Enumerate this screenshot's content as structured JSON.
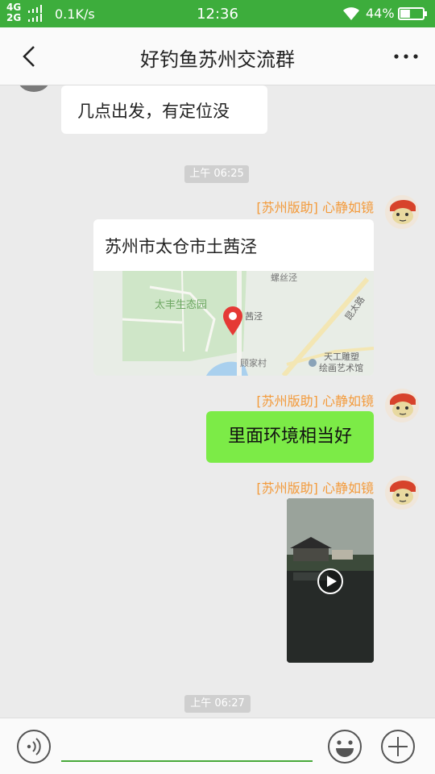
{
  "status_bar": {
    "network_top": "4G",
    "network_bottom": "2G",
    "speed": "0.1K/s",
    "time": "12:36",
    "battery_pct": "44%",
    "signal_icon": "signal-icon",
    "wifi_icon": "wifi-icon",
    "battery_icon": "battery-icon",
    "battery_level": 0.44
  },
  "header": {
    "title": "好钓鱼苏州交流群",
    "back_icon": "chevron-left-icon",
    "more_icon": "more-icon"
  },
  "messages": {
    "m1_text": "几点出发，有定位没",
    "time1": "上午 06:25",
    "sender": "[苏州版助] 心静如镜",
    "location_title": "苏州市太仓市土茜泾",
    "map_labels": {
      "park": "太丰生态园",
      "village_top": "螺丝泾",
      "road": "昆太路",
      "spot": "茜泾",
      "village": "顾家村",
      "museum_line1": "天工雕塑",
      "museum_line2": "绘画艺术馆"
    },
    "m3_text": "里面环境相当好",
    "time2": "上午 06:27",
    "play_icon": "play-icon"
  },
  "input_bar": {
    "placeholder": "",
    "voice_icon": "voice-icon",
    "emoji_icon": "emoji-icon",
    "plus_icon": "plus-icon"
  },
  "colors": {
    "status_bar": "#3dad3c",
    "sender": "#f39a3a",
    "my_bubble": "#7ceb47",
    "input_underline": "#47a93a",
    "pin": "#e53935"
  }
}
